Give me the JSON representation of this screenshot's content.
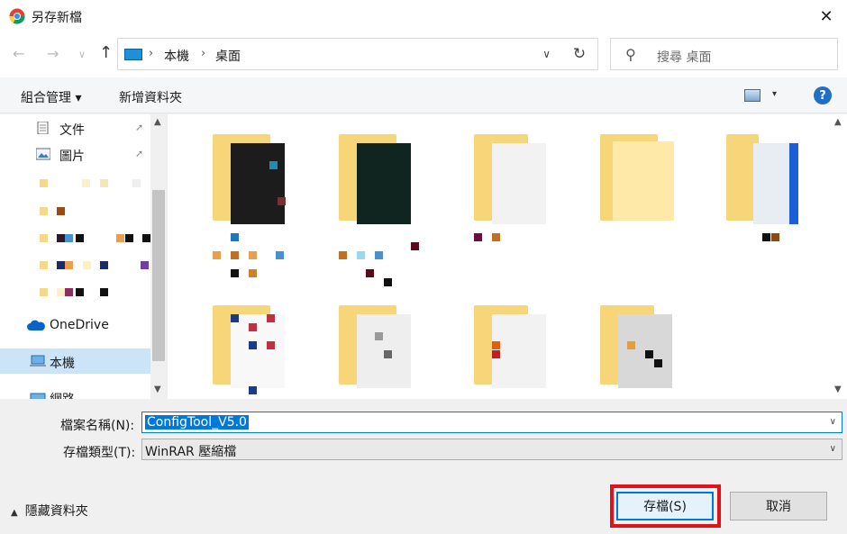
{
  "window": {
    "title": "另存新檔",
    "close_label": "✕"
  },
  "nav": {
    "back": "←",
    "forward": "→",
    "recent": "∨",
    "up": "↑",
    "breadcrumbs": [
      "本機",
      "桌面"
    ],
    "separator": "›",
    "dropdown": "∨",
    "refresh": "↻",
    "search_placeholder": "搜尋 桌面"
  },
  "toolbar": {
    "organize": "組合管理 ▾",
    "new_folder": "新增資料夾",
    "help": "?",
    "view_caret": "▾"
  },
  "sidebar": {
    "items": [
      {
        "label": "文件",
        "icon": "document-icon",
        "pinned": true
      },
      {
        "label": "圖片",
        "icon": "picture-icon",
        "pinned": true
      },
      {
        "label": "OneDrive",
        "icon": "cloud-icon",
        "pinned": false
      },
      {
        "label": "本機",
        "icon": "computer-icon",
        "pinned": false,
        "selected": true
      },
      {
        "label": "網路",
        "icon": "network-icon",
        "pinned": false
      }
    ],
    "pin_glyph": "📌"
  },
  "form": {
    "filename_label": "檔案名稱(N):",
    "filename_value": "ConfigTool_V5.0",
    "filetype_label": "存檔類型(T):",
    "filetype_value": "WinRAR 壓縮檔",
    "caret": "∨",
    "hide_folders": "隱藏資料夾",
    "save_button": "存檔(S)",
    "cancel_button": "取消"
  },
  "colors": {
    "accent": "#0078d7",
    "highlight_box": "#e0131b",
    "folder": "#f7d67a"
  }
}
